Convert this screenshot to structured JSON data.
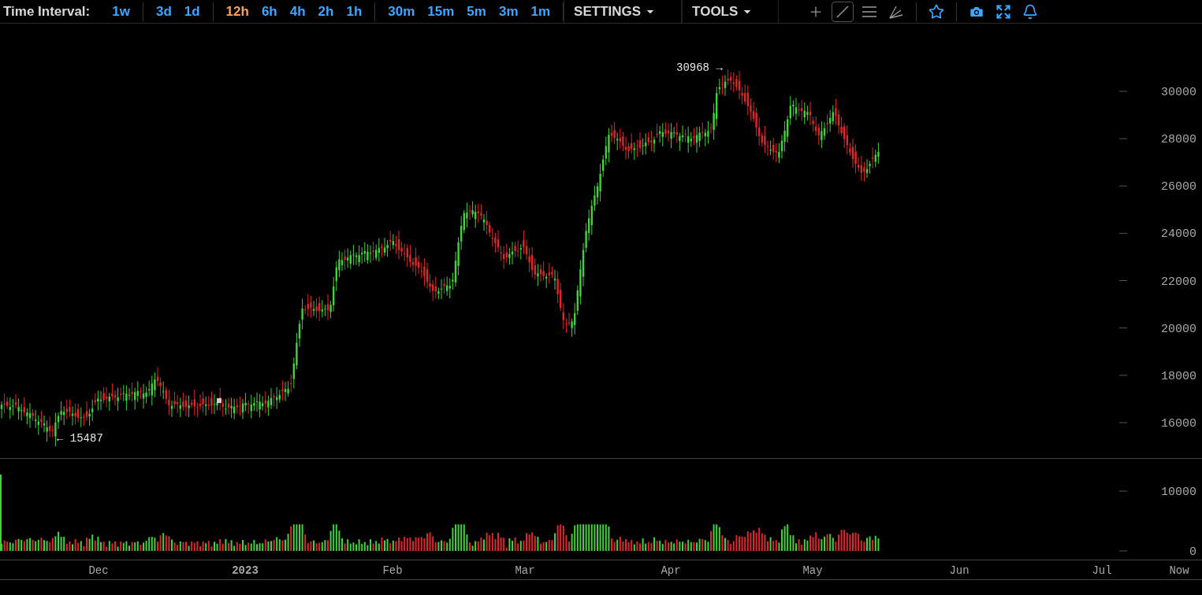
{
  "toolbar": {
    "label": "Time Interval:",
    "interval_groups": [
      [
        {
          "label": "1w",
          "selected": false
        }
      ],
      [
        {
          "label": "3d",
          "selected": false
        },
        {
          "label": "1d",
          "selected": false
        }
      ],
      [
        {
          "label": "12h",
          "selected": true
        },
        {
          "label": "6h",
          "selected": false
        },
        {
          "label": "4h",
          "selected": false
        },
        {
          "label": "2h",
          "selected": false
        },
        {
          "label": "1h",
          "selected": false
        }
      ],
      [
        {
          "label": "30m",
          "selected": false
        },
        {
          "label": "15m",
          "selected": false
        },
        {
          "label": "5m",
          "selected": false
        },
        {
          "label": "3m",
          "selected": false
        },
        {
          "label": "1m",
          "selected": false
        }
      ]
    ],
    "menus": [
      {
        "label": "SETTINGS"
      },
      {
        "label": "TOOLS"
      }
    ],
    "tools": [
      {
        "kind": "crosshair",
        "selected": false
      },
      {
        "kind": "trend_line",
        "selected": true
      },
      {
        "kind": "horizontal_lines",
        "selected": false
      },
      {
        "kind": "fan",
        "selected": false
      },
      {
        "kind": "favorite",
        "selected": false
      },
      {
        "kind": "screenshot",
        "selected": false
      },
      {
        "kind": "fullscreen",
        "selected": false
      },
      {
        "kind": "alert",
        "selected": false
      }
    ]
  },
  "price_axis": {
    "ticks": [
      "30000",
      "28000",
      "26000",
      "24000",
      "22000",
      "20000",
      "18000",
      "16000"
    ]
  },
  "annotations": {
    "high": "30968 →",
    "low": "← 15487"
  },
  "volume_axis": {
    "ticks": [
      "10000",
      "0"
    ]
  },
  "time_axis": [
    {
      "label": "Dec",
      "emphasized": false
    },
    {
      "label": "2023",
      "emphasized": true
    },
    {
      "label": "Feb",
      "emphasized": false
    },
    {
      "label": "Mar",
      "emphasized": false
    },
    {
      "label": "Apr",
      "emphasized": false
    },
    {
      "label": "May",
      "emphasized": false
    },
    {
      "label": "Jun",
      "emphasized": false
    },
    {
      "label": "Jul",
      "emphasized": false
    },
    {
      "label": "Now",
      "emphasized": false
    }
  ]
}
